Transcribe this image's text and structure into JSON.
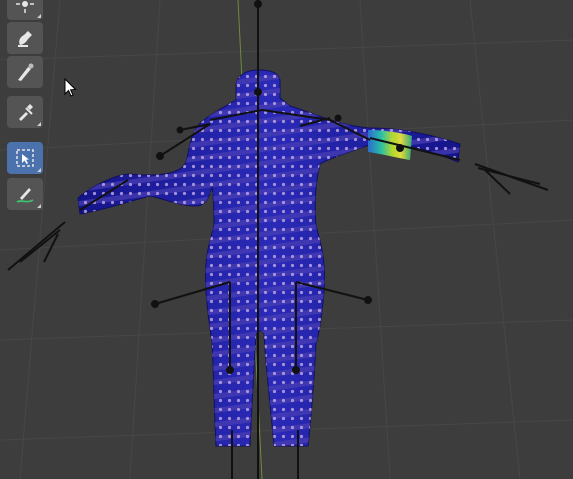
{
  "viewport": {
    "background": "#3d3d3d",
    "grid_color": "#474747",
    "mesh_color": "#1d1d9a",
    "vertex_dot_color": "#b9a0dc",
    "bone_color": "#111111"
  },
  "toolbar": {
    "tools": [
      {
        "name": "tool-sample-weight",
        "icon": "sparkle-icon",
        "active": false
      },
      {
        "name": "tool-weight-brush",
        "icon": "brush-icon",
        "active": false
      },
      {
        "name": "tool-blur",
        "icon": "smear-icon",
        "active": false
      },
      {
        "name": "tool-gradient",
        "icon": "dropper-icon",
        "active": false
      },
      {
        "name": "tool-select-box",
        "icon": "select-box-icon",
        "active": true
      },
      {
        "name": "tool-annotate",
        "icon": "annotate-icon",
        "active": false
      }
    ]
  },
  "cursor": {
    "icon": "mouse-pointer-icon"
  }
}
